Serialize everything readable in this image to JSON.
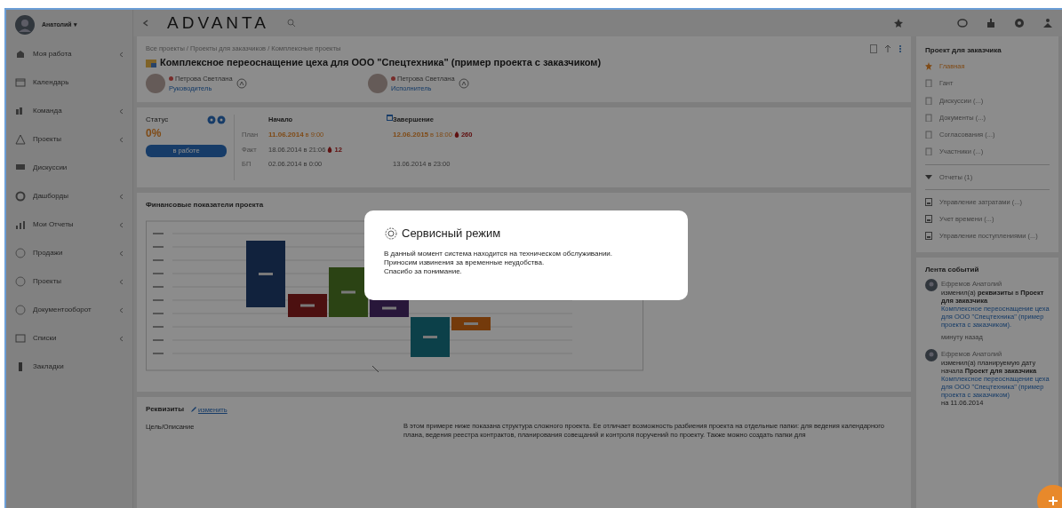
{
  "user": {
    "name": "Анатолий ▾"
  },
  "sidebar": {
    "items": [
      {
        "label": "Моя работа",
        "expandable": true
      },
      {
        "label": "Календарь",
        "expandable": false
      },
      {
        "label": "Команда",
        "expandable": true
      },
      {
        "label": "Проекты",
        "expandable": true
      },
      {
        "label": "Дискуссии",
        "expandable": false
      },
      {
        "label": "Дашборды",
        "expandable": true
      },
      {
        "label": "Мои Отчеты",
        "expandable": true
      },
      {
        "label": "Продажи",
        "expandable": true
      },
      {
        "label": "Проекты",
        "expandable": true
      },
      {
        "label": "Документооборот",
        "expandable": true
      },
      {
        "label": "Списки",
        "expandable": true
      },
      {
        "label": "Закладки",
        "expandable": false
      }
    ]
  },
  "header": {
    "logo": "ADVANTA"
  },
  "project": {
    "breadcrumb": "Все проекты / Проекты для заказчиков / Комплексные проекты",
    "title": "Комплексное переоснащение цеха для ООО \"Спецтехника\" (пример проекта с заказчиком)",
    "people": [
      {
        "name": "Петрова Светлана",
        "role": "Руководитель"
      },
      {
        "name": "Петрова Светлана",
        "role": "Исполнитель"
      }
    ]
  },
  "status": {
    "label": "Статус",
    "percent": "0%",
    "state_button": "в работе",
    "start_label": "Начало",
    "end_label": "Завершение",
    "rows": [
      {
        "label": "План",
        "start_date": "11.06.2014",
        "start_time": "в 9:00",
        "end_date": "12.06.2015",
        "end_time": "в 18:00",
        "end_delay": "260",
        "kind": "plan"
      },
      {
        "label": "Факт",
        "start_date": "18.06.2014 в 21:06",
        "start_delay": "12",
        "kind": "fact"
      },
      {
        "label": "БП",
        "start_date": "02.06.2014 в 0:00",
        "end_date": "13.06.2014 в 23:00",
        "kind": "fact"
      }
    ]
  },
  "finance": {
    "title": "Финансовые показатели проекта"
  },
  "requisites": {
    "title": "Реквизиты",
    "edit_link": "изменить",
    "field_label": "Цель/Описание",
    "field_value": "В этом примере ниже показана структура сложного проекта. Ее отличает возможность разбиения проекта на отдельные папки: для ведения календарного плана, ведения реестра контрактов, планирования совещаний и контроля поручений по проекту. Также можно создать папки для"
  },
  "modal": {
    "title": "Сервисный режим",
    "lines": [
      "В данный момент система находится на техническом обслуживании.",
      "Приносим извинения за временные неудобства.",
      "Спасибо за понимание."
    ]
  },
  "project_menu": {
    "title": "Проект для заказчика",
    "items": [
      {
        "label": "Главная",
        "selected": true,
        "kind": "link"
      },
      {
        "label": "Гант",
        "selected": false,
        "kind": "link"
      },
      {
        "label": "Дискуссии (...)",
        "selected": false,
        "kind": "link"
      },
      {
        "label": "Документы (...)",
        "selected": false,
        "kind": "link"
      },
      {
        "label": "Согласования (...)",
        "selected": false,
        "kind": "link"
      },
      {
        "label": "Участники (...)",
        "selected": false,
        "kind": "link"
      },
      {
        "label": "Отчеты (1)",
        "selected": false,
        "kind": "group"
      },
      {
        "label": "Управление затратами (...)",
        "selected": false,
        "kind": "report"
      },
      {
        "label": "Учет времени (...)",
        "selected": false,
        "kind": "report"
      },
      {
        "label": "Управление поступлениями (...)",
        "selected": false,
        "kind": "report"
      }
    ]
  },
  "feed": {
    "title": "Лента событий",
    "entries": [
      {
        "author": "Ефремов Анатолий",
        "action": "изменил(а) **реквизиты** в **Проект для заказчика**",
        "link": "Комплексное переоснащение цеха для ООО \"Спецтехника\" (пример проекта с заказчиком).",
        "time": "минуту назад"
      },
      {
        "author": "Ефремов Анатолий",
        "action": "изменил(а) планируемую дату начала **Проект для заказчика**",
        "link": "Комплексное переоснащение цеха для ООО \"Спецтехника\" (пример проекта с заказчиком)",
        "tail": "на 11.06.2014"
      }
    ]
  }
}
